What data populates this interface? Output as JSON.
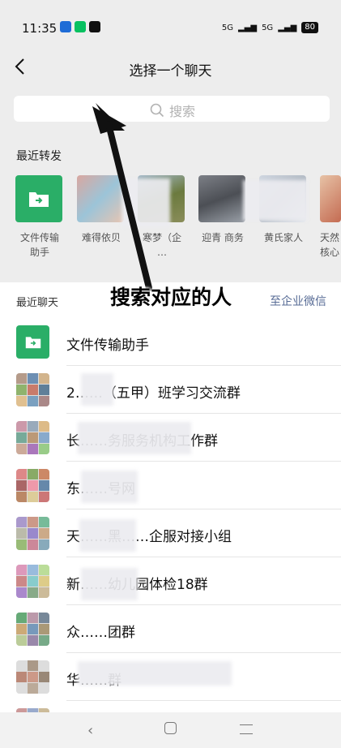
{
  "status": {
    "time": "11:35",
    "signal1": "5G",
    "signal2": "5G",
    "battery": "80"
  },
  "nav": {
    "title": "选择一个聊天"
  },
  "search": {
    "placeholder": "搜索"
  },
  "recent_forward": {
    "label": "最近转发",
    "items": [
      {
        "name": "文件传输\n助手",
        "line1": "文件传输",
        "line2": "助手"
      },
      {
        "name": "难得依贝",
        "line1": "难得依贝",
        "line2": ""
      },
      {
        "name": "寒梦（企…",
        "line1": "寒梦（企",
        "line2": "…"
      },
      {
        "name": "迎青 商务",
        "line1": "迎青 商务",
        "line2": ""
      },
      {
        "name": "黄氏家人",
        "line1": "黄氏家人",
        "line2": ""
      },
      {
        "name": "天然核心",
        "line1": "天然",
        "line2": "核心"
      }
    ]
  },
  "recent_chats": {
    "label": "最近聊天",
    "enterprise_link": "至企业微信",
    "items": [
      {
        "name": "文件传输助手"
      },
      {
        "name": "2……（五甲）班学习交流群"
      },
      {
        "name": "长……务服务机构工作群"
      },
      {
        "name": "东……号网"
      },
      {
        "name": "天……黑……企服对接小组"
      },
      {
        "name": "新……幼儿园体检18群"
      },
      {
        "name": "众……团群"
      },
      {
        "name": "华……群"
      }
    ]
  },
  "annotation": {
    "text": "搜索对应的人"
  },
  "colors": {
    "wechat_green": "#2aae67",
    "link_blue": "#576b95",
    "bg": "#ededed"
  }
}
